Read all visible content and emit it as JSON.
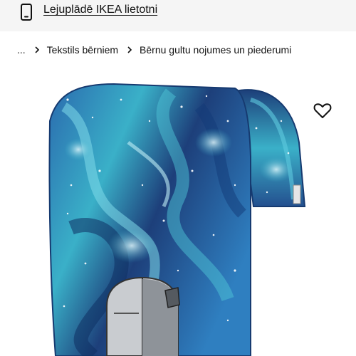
{
  "app_banner": {
    "icon": "smartphone-icon",
    "link_text": "Lejuplādē IKEA lietotni"
  },
  "breadcrumb": {
    "ellipsis": "...",
    "items": [
      {
        "label": "Tekstils bērniem"
      },
      {
        "label": "Bērnu gultu nojumes un piederumi"
      }
    ]
  },
  "product_image": {
    "subject": "bed-canopy",
    "colors": {
      "dark": "#1d3f7a",
      "mid": "#2a6aae",
      "teal": "#3ab0c8"
    }
  },
  "favourite": {
    "icon": "heart-outline-icon"
  }
}
